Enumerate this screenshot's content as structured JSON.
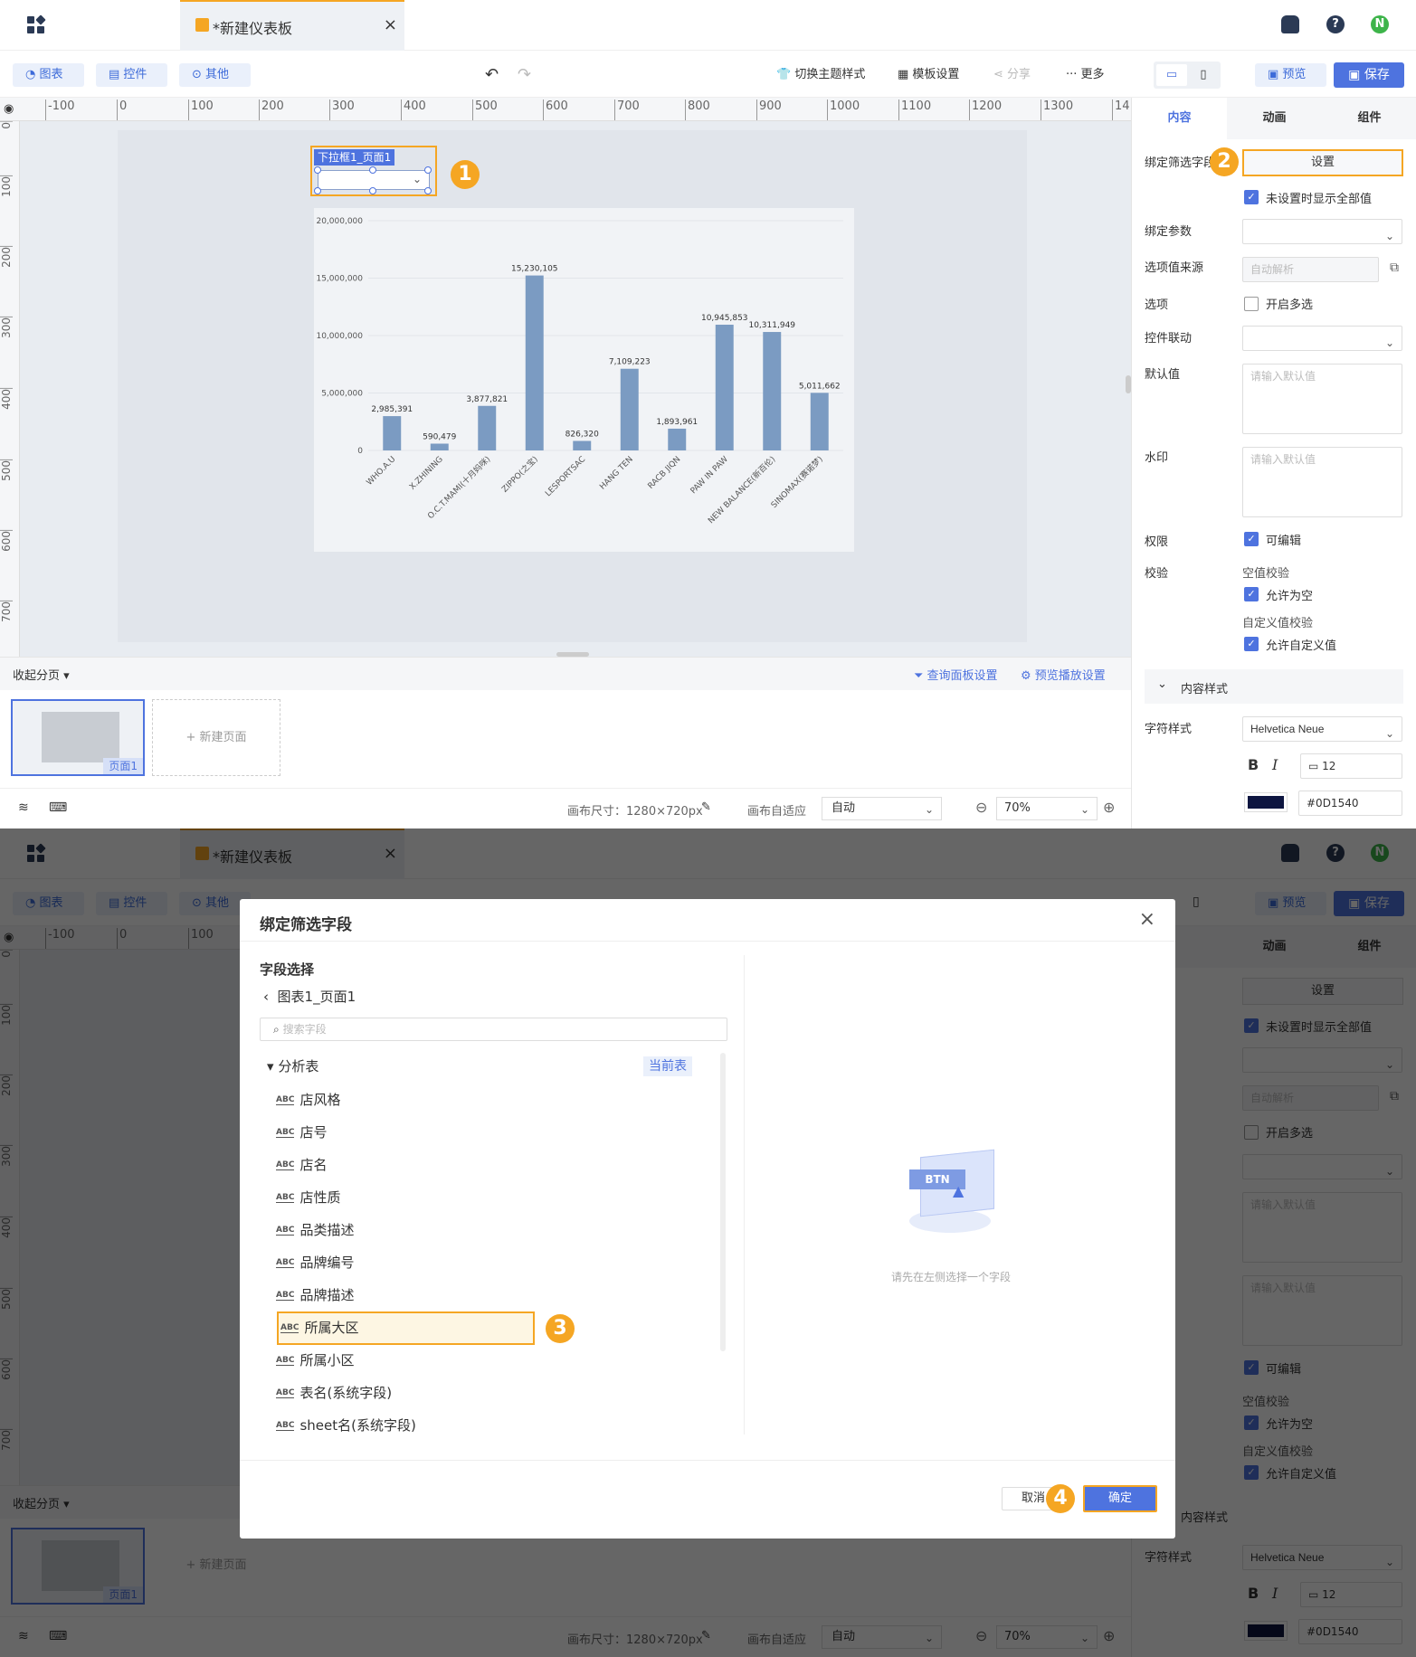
{
  "top": {
    "tab_title": "*新建仪表板",
    "close": "×",
    "avatar": "N"
  },
  "toolbar": {
    "left_buttons": [
      "图表",
      "控件",
      "其他"
    ],
    "right_items": [
      "切换主题样式",
      "模板设置",
      "分享",
      "更多"
    ],
    "preview": "预览",
    "save": "保存"
  },
  "ruler": {
    "h_ticks": [
      "-100",
      "0",
      "100",
      "200",
      "300",
      "400",
      "500",
      "600",
      "700",
      "800",
      "900",
      "1000",
      "1100",
      "1200",
      "1300",
      "14"
    ],
    "v_ticks": [
      "0",
      "100",
      "200",
      "300",
      "400",
      "500",
      "600",
      "700"
    ]
  },
  "dropdown": {
    "label": "下拉框1_页面1"
  },
  "badges": [
    "1",
    "2",
    "3",
    "4"
  ],
  "chart_data": {
    "type": "bar",
    "categories": [
      "WHO.A.U",
      "X.ZHINING",
      "O.C.T.MAMI(十月妈咪)",
      "ZIPPO(之宝)",
      "LESPORTSAC",
      "HANG TEN",
      "RACB JIQN",
      "PAW IN PAW",
      "NEW BALANCE(新百伦)",
      "SINOMAX(赛诺梦)"
    ],
    "values": [
      2985391,
      590479,
      3877821,
      15230105,
      826320,
      7109223,
      1893961,
      10945853,
      10311949,
      5011662
    ],
    "value_labels": [
      "2,985,391",
      "590,479",
      "3,877,821",
      "15,230,105",
      "826,320",
      "7,109,223",
      "1,893,961",
      "10,945,853",
      "10,311,949",
      "5,011,662"
    ],
    "y_ticks": [
      "0",
      "5,000,000",
      "10,000,000",
      "15,000,000",
      "20,000,000"
    ],
    "ylim": [
      0,
      20000000
    ],
    "color": "#7b9bc2"
  },
  "right_panel": {
    "tabs": [
      "内容",
      "动画",
      "组件"
    ],
    "bind_field_label": "绑定筛选字段",
    "set_button": "设置",
    "show_all": "未设置时显示全部值",
    "bind_param": "绑定参数",
    "option_source": "选项值来源",
    "option_source_placeholder": "自动解析",
    "options": "选项",
    "multi": "开启多选",
    "linkage": "控件联动",
    "default": "默认值",
    "default_placeholder": "请输入默认值",
    "watermark": "水印",
    "watermark_placeholder": "请输入默认值",
    "permission": "权限",
    "editable": "可编辑",
    "validation": "校验",
    "empty_check": "空值校验",
    "allow_empty": "允许为空",
    "custom_check": "自定义值校验",
    "allow_custom": "允许自定义值",
    "content_style": "内容样式",
    "font_style": "字符样式",
    "font_name": "Helvetica Neue",
    "bold": "B",
    "italic": "I",
    "font_size": "12",
    "color_hex": "#0D1540",
    "color_value": "#0d1540"
  },
  "bottom": {
    "collapse": "收起分页",
    "query_settings": "查询面板设置",
    "preview_settings": "预览播放设置",
    "page_name": "页面1",
    "new_page": "新建页面",
    "canvas_size": "画布尺寸：1280×720px",
    "canvas_fit": "画布自适应",
    "fit_value": "自动",
    "zoom": "70%"
  },
  "modal": {
    "title": "绑定筛选字段",
    "section": "字段选择",
    "back_label": "图表1_页面1",
    "search_placeholder": "搜索字段",
    "table_name": "分析表",
    "current_tag": "当前表",
    "fields": [
      "店风格",
      "店号",
      "店名",
      "店性质",
      "品类描述",
      "品牌编号",
      "品牌描述",
      "所属大区",
      "所属小区",
      "表名(系统字段)",
      "sheet名(系统字段)"
    ],
    "abc": "ABC",
    "empty_hint": "请先在左侧选择一个字段",
    "illustration_text": "BTN",
    "cancel": "取消",
    "ok": "确定"
  }
}
